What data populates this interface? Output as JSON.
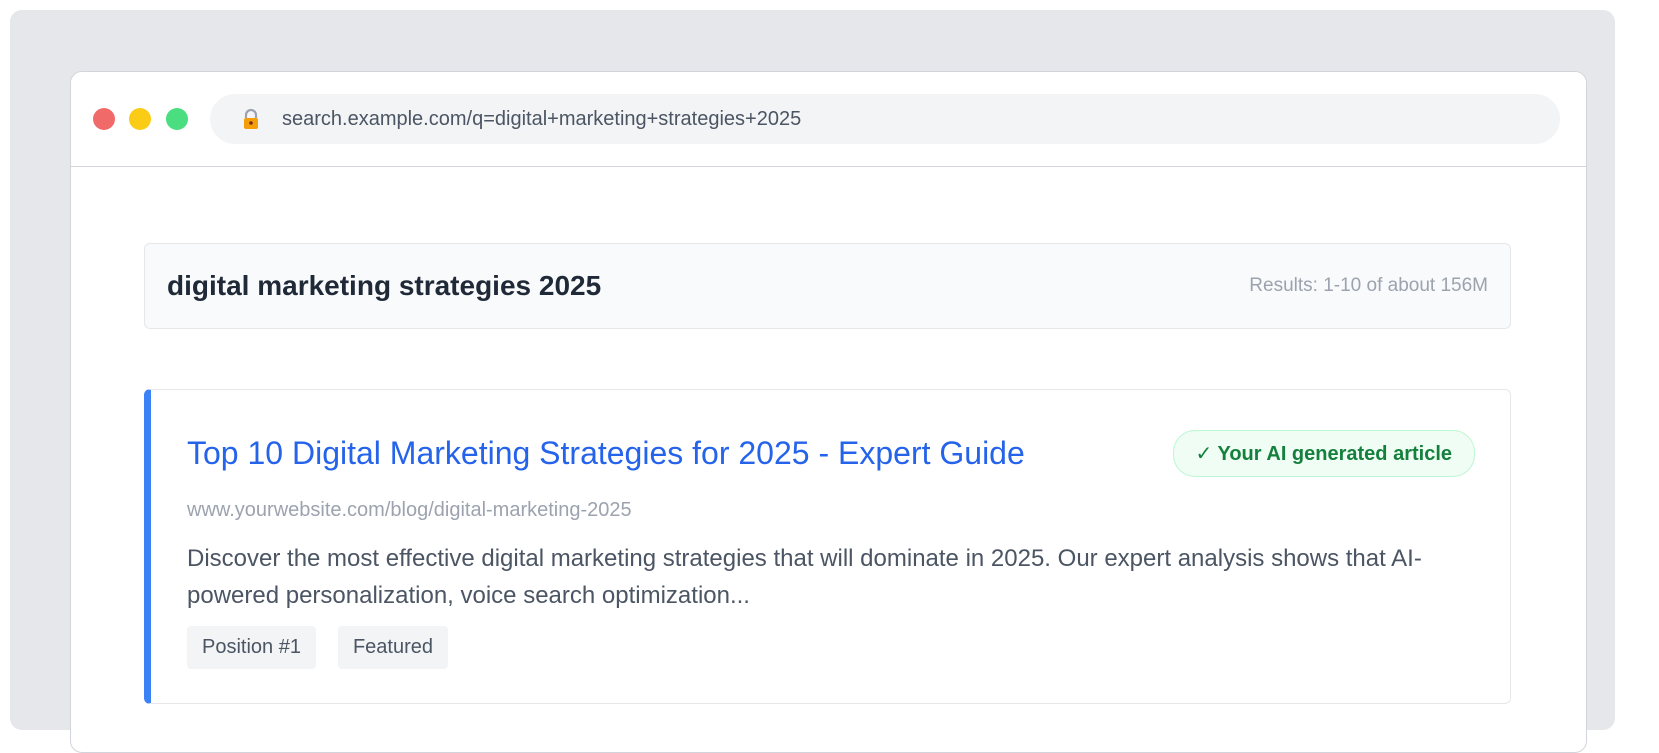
{
  "browser": {
    "url": "search.example.com/q=digital+marketing+strategies+2025",
    "lock_icon": "lock-icon",
    "window_controls": [
      "close",
      "minimize",
      "maximize"
    ]
  },
  "search": {
    "query": "digital marketing strategies 2025",
    "results_count": "Results: 1-10 of about 156M"
  },
  "result": {
    "title": "Top 10 Digital Marketing Strategies for 2025 - Expert Guide",
    "badge": "✓ Your AI generated article",
    "url": "www.yourwebsite.com/blog/digital-marketing-2025",
    "snippet": "Discover the most effective digital marketing strategies that will dominate in 2025. Our expert analysis shows that AI-powered personalization, voice search optimization...",
    "tags": [
      "Position #1",
      "Featured"
    ]
  },
  "colors": {
    "accent": "#3b82f6",
    "link": "#2563eb",
    "badge_green": "#15803d"
  }
}
